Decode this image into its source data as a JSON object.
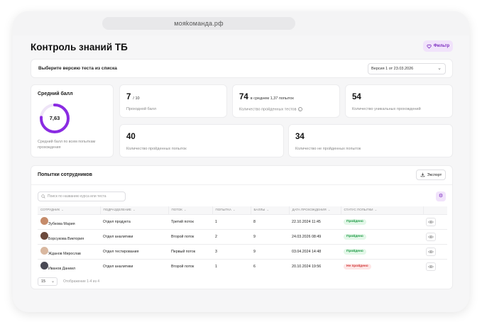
{
  "browser": {
    "url": "мояkоманда.рф"
  },
  "page": {
    "title": "Контроль знаний ТБ",
    "filter_label": "Фильтр"
  },
  "version": {
    "label": "Выберите версию теста из списка",
    "selected": "Версия 1 от 23.03.2026"
  },
  "average": {
    "title": "Средний балл",
    "value": "7,63",
    "progress": 0.763,
    "description": "Средний балл по всем попыткам прохождения",
    "ring_color": "#8a2be2"
  },
  "stats": [
    {
      "value": "7",
      "suffix": "/ 10",
      "label": "Проходной балл"
    },
    {
      "value": "74",
      "suffix": "в среднем 1,37 попыток",
      "label": "Количество пройденных тестов"
    },
    {
      "value": "54",
      "suffix": "",
      "label": "Количество уникальных прохождений"
    },
    {
      "value": "40",
      "suffix": "",
      "label": "Количество пройденных попыток"
    },
    {
      "value": "34",
      "suffix": "",
      "label": "Количество не пройденных попыток"
    }
  ],
  "attempts": {
    "title": "Попытки сотрудников",
    "export_label": "Экспорт",
    "search_placeholder": "Поиск по названию курса или теста",
    "columns": [
      "Сотрудник",
      "Подразделение",
      "Поток",
      "Попытка",
      "Баллы",
      "Дата прохождения",
      "Статус попытки"
    ],
    "rows": [
      {
        "name": "Зубкова Мария",
        "dept": "Отдел продукта",
        "stream": "Третий поток",
        "attempt": "1",
        "score": "8",
        "date": "22.10.2024 11:45",
        "status": "Пройдено",
        "passed": true,
        "avatar": "#c58b6a"
      },
      {
        "name": "Борсукова Виктория",
        "dept": "Отдел аналитики",
        "stream": "Второй поток",
        "attempt": "2",
        "score": "9",
        "date": "24.03.2026 08:49",
        "status": "Пройдено",
        "passed": true,
        "avatar": "#6b4a3c"
      },
      {
        "name": "Жданов Мирослав",
        "dept": "Отдел тестирования",
        "stream": "Первый поток",
        "attempt": "3",
        "score": "9",
        "date": "03.04.2024 14:48",
        "status": "Пройдено",
        "passed": true,
        "avatar": "#d9b8a0"
      },
      {
        "name": "Иванов Даниил",
        "dept": "Отдел аналитики",
        "stream": "Второй поток",
        "attempt": "1",
        "score": "6",
        "date": "20.10.2024 19:56",
        "status": "Не пройдено",
        "passed": false,
        "avatar": "#4a4a55"
      }
    ],
    "per_page": "15",
    "showing": "Отображение 1-4 из 4"
  }
}
